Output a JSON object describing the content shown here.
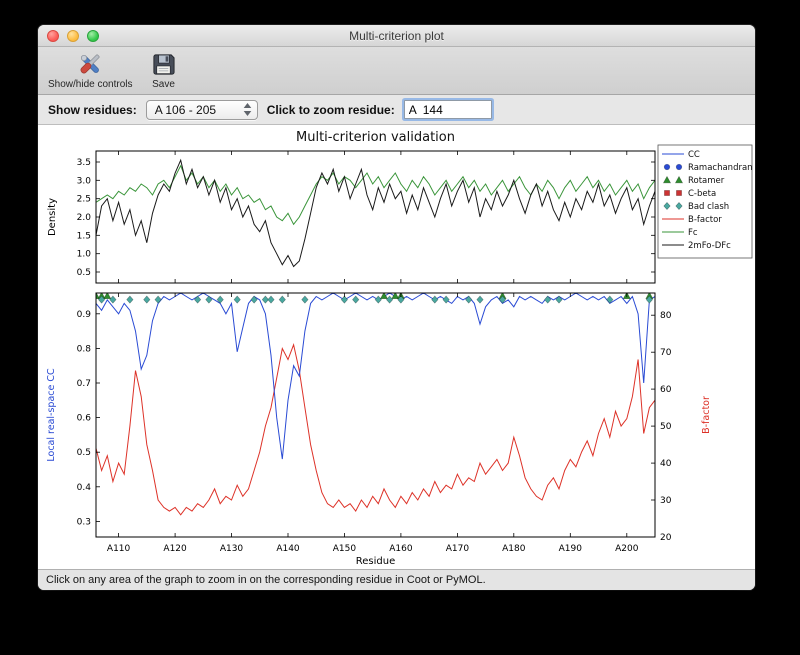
{
  "window": {
    "title": "Multi-criterion plot"
  },
  "toolbar": {
    "show_hide_label": "Show/hide controls",
    "save_label": "Save"
  },
  "controls": {
    "show_residues_label": "Show residues:",
    "range_value": "A 106 - 205",
    "zoom_label": "Click to zoom residue:",
    "zoom_value": "A  144"
  },
  "statusbar": {
    "text": "Click on any area of the graph to zoom in on the corresponding residue in Coot or PyMOL."
  },
  "chart_data": {
    "type": "line",
    "title": "Multi-criterion validation",
    "x_start": 106,
    "x_end": 205,
    "xlabel": "Residue",
    "x_tick_values": [
      110,
      120,
      130,
      140,
      150,
      160,
      170,
      180,
      190,
      200
    ],
    "x_tick_labels": [
      "A110",
      "A120",
      "A130",
      "A140",
      "A150",
      "A160",
      "A170",
      "A180",
      "A190",
      "A200"
    ],
    "top": {
      "ylabel": "Density",
      "ylim": [
        0.2,
        3.8
      ],
      "yticks": [
        0.5,
        1.0,
        1.5,
        2.0,
        2.5,
        3.0,
        3.5
      ],
      "series": [
        {
          "name": "Fc",
          "color": "#3a953a",
          "values": [
            2.4,
            2.5,
            2.6,
            2.5,
            2.7,
            2.6,
            2.8,
            2.7,
            2.9,
            2.8,
            2.6,
            2.9,
            3.0,
            2.8,
            3.1,
            3.4,
            3.0,
            3.2,
            2.9,
            3.1,
            2.8,
            3.0,
            2.7,
            2.9,
            2.6,
            2.8,
            2.5,
            2.6,
            2.4,
            2.5,
            2.2,
            2.3,
            2.0,
            1.9,
            2.1,
            1.8,
            2.0,
            2.3,
            2.6,
            2.9,
            3.1,
            3.0,
            3.2,
            2.9,
            3.1,
            3.0,
            2.8,
            3.0,
            3.2,
            2.9,
            3.1,
            2.8,
            3.0,
            3.2,
            2.9,
            2.7,
            3.0,
            2.8,
            3.1,
            2.9,
            2.6,
            2.8,
            3.0,
            2.7,
            2.9,
            3.1,
            2.8,
            3.0,
            2.7,
            2.9,
            2.6,
            2.8,
            3.0,
            2.7,
            2.9,
            3.1,
            2.8,
            2.6,
            2.9,
            2.7,
            3.0,
            2.8,
            2.5,
            2.8,
            3.0,
            2.7,
            2.9,
            3.1,
            2.8,
            3.0,
            2.7,
            2.9,
            2.6,
            2.8,
            3.0,
            2.7,
            2.9,
            2.5,
            2.8,
            3.0
          ]
        },
        {
          "name": "2mFo-DFc",
          "color": "#1a1a1a",
          "values": [
            1.5,
            2.3,
            2.5,
            1.9,
            2.4,
            1.8,
            2.2,
            1.5,
            1.9,
            1.3,
            2.1,
            2.6,
            2.9,
            2.7,
            3.2,
            3.55,
            2.9,
            3.3,
            2.8,
            3.1,
            2.6,
            3.0,
            2.4,
            2.8,
            2.2,
            2.5,
            2.0,
            2.3,
            1.8,
            1.6,
            1.9,
            1.3,
            1.0,
            0.7,
            0.95,
            0.65,
            0.8,
            1.4,
            2.1,
            2.8,
            3.2,
            2.9,
            3.3,
            2.7,
            3.1,
            2.5,
            2.9,
            3.3,
            2.6,
            2.2,
            2.8,
            2.4,
            2.9,
            2.5,
            2.7,
            2.1,
            2.6,
            2.2,
            2.8,
            2.4,
            2.0,
            2.5,
            2.9,
            2.3,
            2.7,
            3.0,
            2.4,
            2.8,
            2.0,
            2.5,
            2.2,
            2.7,
            2.3,
            2.6,
            3.0,
            2.5,
            2.1,
            2.6,
            2.9,
            2.3,
            2.7,
            2.2,
            1.9,
            2.4,
            2.0,
            2.5,
            2.2,
            2.7,
            2.4,
            2.9,
            2.3,
            2.6,
            2.1,
            2.5,
            2.8,
            2.2,
            2.5,
            1.8,
            2.3,
            2.7
          ]
        }
      ]
    },
    "bottom": {
      "ylabel_left": "Local real-space CC",
      "left_color": "#2a4bd4",
      "ylim_left": [
        0.255,
        0.96
      ],
      "yticks_left": [
        0.3,
        0.4,
        0.5,
        0.6,
        0.7,
        0.8,
        0.9
      ],
      "ylabel_right": "B-factor",
      "right_color": "#dd3228",
      "ylim_right": [
        20,
        86
      ],
      "yticks_right": [
        20,
        30,
        40,
        50,
        60,
        70,
        80
      ],
      "cc": {
        "name": "CC",
        "color": "#2a4bd4",
        "values": [
          0.93,
          0.91,
          0.94,
          0.92,
          0.9,
          0.93,
          0.91,
          0.85,
          0.74,
          0.78,
          0.88,
          0.93,
          0.95,
          0.94,
          0.95,
          0.96,
          0.95,
          0.94,
          0.95,
          0.96,
          0.95,
          0.94,
          0.93,
          0.9,
          0.93,
          0.79,
          0.86,
          0.93,
          0.95,
          0.94,
          0.9,
          0.78,
          0.6,
          0.48,
          0.65,
          0.75,
          0.72,
          0.85,
          0.93,
          0.95,
          0.94,
          0.95,
          0.96,
          0.95,
          0.94,
          0.95,
          0.96,
          0.95,
          0.94,
          0.95,
          0.94,
          0.95,
          0.96,
          0.95,
          0.94,
          0.95,
          0.94,
          0.95,
          0.96,
          0.95,
          0.94,
          0.95,
          0.94,
          0.93,
          0.95,
          0.94,
          0.95,
          0.93,
          0.87,
          0.92,
          0.94,
          0.95,
          0.93,
          0.94,
          0.92,
          0.95,
          0.94,
          0.95,
          0.94,
          0.93,
          0.95,
          0.94,
          0.95,
          0.94,
          0.95,
          0.96,
          0.95,
          0.94,
          0.95,
          0.94,
          0.95,
          0.93,
          0.94,
          0.95,
          0.93,
          0.95,
          0.9,
          0.7,
          0.94,
          0.95
        ]
      },
      "bfactor": {
        "name": "B-factor",
        "color": "#dd3228",
        "values": [
          44,
          38,
          42,
          35,
          40,
          37,
          50,
          65,
          58,
          45,
          38,
          30,
          28,
          27,
          28,
          26,
          28,
          27,
          29,
          28,
          30,
          33,
          29,
          31,
          30,
          34,
          31,
          33,
          38,
          43,
          50,
          55,
          63,
          71,
          68,
          72,
          65,
          55,
          45,
          38,
          32,
          29,
          28,
          30,
          28,
          29,
          27,
          30,
          28,
          31,
          29,
          33,
          30,
          28,
          31,
          29,
          32,
          30,
          33,
          31,
          35,
          32,
          34,
          33,
          37,
          34,
          36,
          35,
          40,
          37,
          39,
          41,
          38,
          40,
          47,
          42,
          36,
          33,
          31,
          30,
          34,
          36,
          33,
          38,
          41,
          39,
          43,
          46,
          42,
          48,
          52,
          47,
          54,
          50,
          52,
          58,
          68,
          48,
          55,
          57
        ]
      },
      "markers": [
        {
          "name": "Ramachandran",
          "shape": "circle",
          "color": "#2a4bd4",
          "y": 0.948,
          "residues": []
        },
        {
          "name": "Rotamer",
          "shape": "triangle",
          "color": "#2e8b2e",
          "y": 0.952,
          "residues": [
            106,
            107,
            108,
            157,
            159,
            160,
            178,
            200,
            204
          ]
        },
        {
          "name": "C-beta",
          "shape": "square",
          "color": "#cc3333",
          "y": 0.948,
          "residues": []
        },
        {
          "name": "Bad clash",
          "shape": "diamond",
          "color": "#4aa8a0",
          "y": 0.941,
          "residues": [
            107,
            109,
            112,
            115,
            117,
            124,
            126,
            128,
            131,
            134,
            136,
            137,
            139,
            143,
            150,
            152,
            156,
            158,
            160,
            166,
            168,
            172,
            174,
            178,
            186,
            188,
            197,
            204
          ]
        }
      ]
    },
    "legend": [
      {
        "label": "CC",
        "glyph": "line",
        "color": "#2a4bd4"
      },
      {
        "label": "Ramachandran",
        "glyph": "circle",
        "color": "#2a4bd4"
      },
      {
        "label": "Rotamer",
        "glyph": "triangle",
        "color": "#2e8b2e"
      },
      {
        "label": "C-beta",
        "glyph": "square",
        "color": "#cc3333"
      },
      {
        "label": "Bad clash",
        "glyph": "diamond",
        "color": "#4aa8a0"
      },
      {
        "label": "B-factor",
        "glyph": "line",
        "color": "#dd3228"
      },
      {
        "label": "Fc",
        "glyph": "line",
        "color": "#3a953a"
      },
      {
        "label": "2mFo-DFc",
        "glyph": "line",
        "color": "#1a1a1a"
      }
    ]
  }
}
